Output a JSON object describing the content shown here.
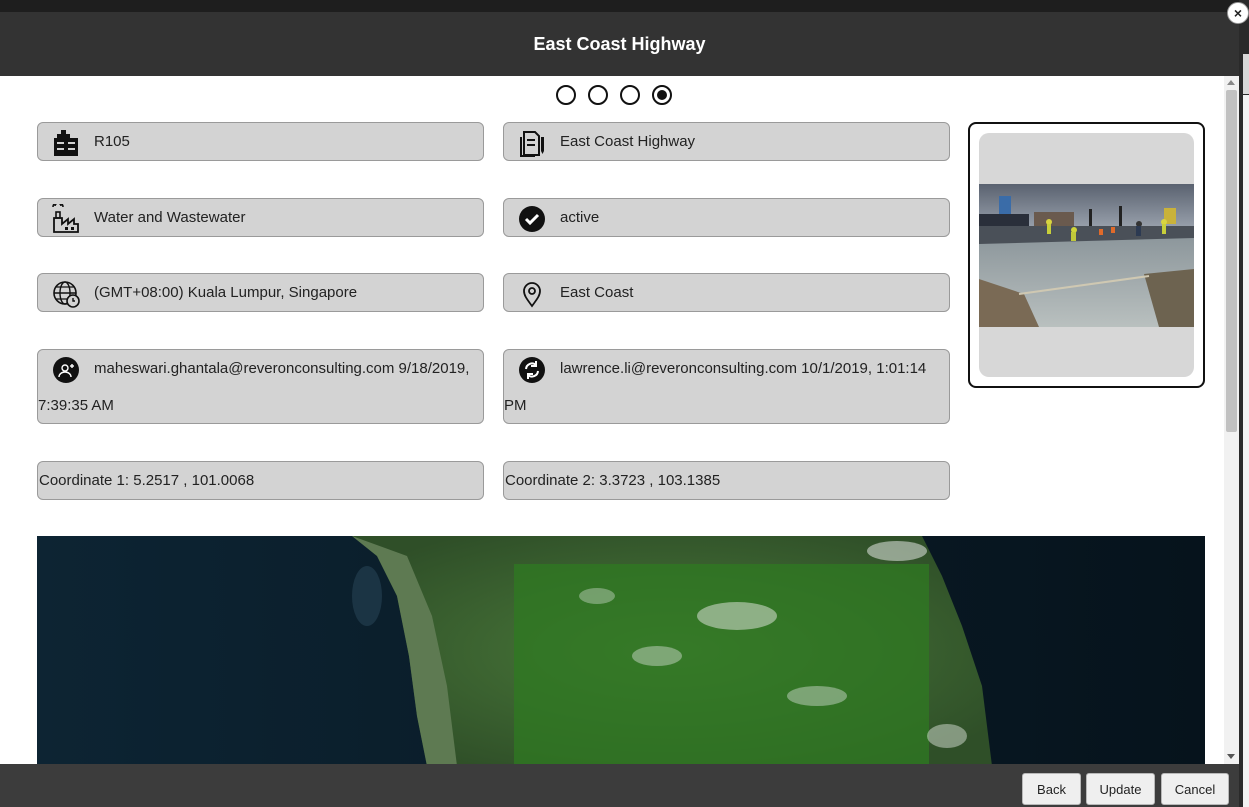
{
  "modal": {
    "title": "East Coast Highway",
    "close_label": "×"
  },
  "wizard": {
    "total_steps": 4,
    "active_step": 4
  },
  "fields": {
    "code": {
      "value": "R105",
      "icon": "building-icon"
    },
    "name": {
      "value": "East Coast Highway",
      "icon": "document-edit-icon"
    },
    "sector": {
      "value": "Water and Wastewater",
      "icon": "factory-icon"
    },
    "status": {
      "value": "active",
      "icon": "check-circle-icon"
    },
    "timezone": {
      "value": "(GMT+08:00) Kuala Lumpur, Singapore",
      "icon": "globe-clock-icon"
    },
    "region": {
      "value": "East Coast",
      "icon": "location-pin-icon"
    },
    "created": {
      "value": "maheswari.ghantala@reveronconsulting.com 9/18/2019, 7:39:35 AM",
      "icon": "user-add-icon"
    },
    "modified": {
      "value": "lawrence.li@reveronconsulting.com 10/1/2019, 1:01:14 PM",
      "icon": "sync-icon"
    },
    "coord1": {
      "value": "Coordinate 1: 5.2517 , 101.0068"
    },
    "coord2": {
      "value": "Coordinate 2: 3.3723 , 103.1385"
    }
  },
  "photo": {
    "subject": "road-construction-photo"
  },
  "map": {
    "style": "satellite"
  },
  "footer": {
    "back_label": "Back",
    "update_label": "Update",
    "cancel_label": "Cancel"
  },
  "colors": {
    "header_bg": "#333333",
    "field_bg": "#d3d3d3",
    "footer_bg": "#3c3c3c"
  }
}
